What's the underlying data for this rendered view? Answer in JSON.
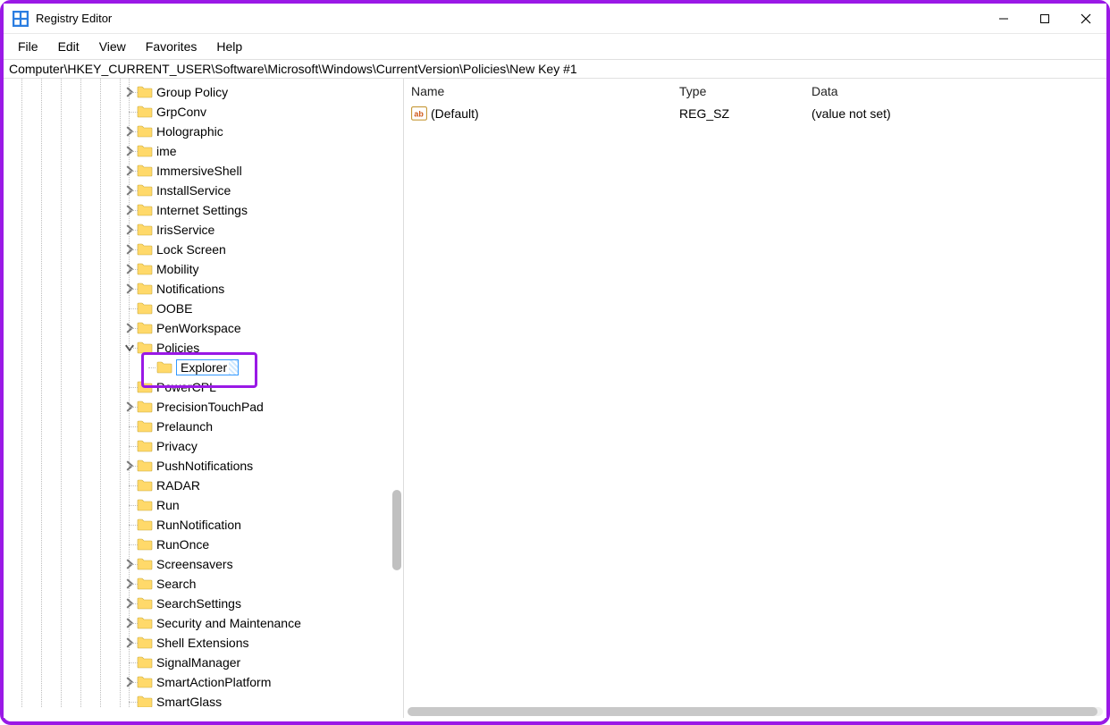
{
  "window": {
    "title": "Registry Editor"
  },
  "menu": {
    "file": "File",
    "edit": "Edit",
    "view": "View",
    "favorites": "Favorites",
    "help": "Help"
  },
  "address": "Computer\\HKEY_CURRENT_USER\\Software\\Microsoft\\Windows\\CurrentVersion\\Policies\\New Key #1",
  "tree": {
    "items": [
      {
        "label": "Group Policy",
        "expandable": true
      },
      {
        "label": "GrpConv",
        "expandable": false
      },
      {
        "label": "Holographic",
        "expandable": true
      },
      {
        "label": "ime",
        "expandable": true
      },
      {
        "label": "ImmersiveShell",
        "expandable": true
      },
      {
        "label": "InstallService",
        "expandable": true
      },
      {
        "label": "Internet Settings",
        "expandable": true
      },
      {
        "label": "IrisService",
        "expandable": true
      },
      {
        "label": "Lock Screen",
        "expandable": true
      },
      {
        "label": "Mobility",
        "expandable": true
      },
      {
        "label": "Notifications",
        "expandable": true
      },
      {
        "label": "OOBE",
        "expandable": false
      },
      {
        "label": "PenWorkspace",
        "expandable": true
      },
      {
        "label": "Policies",
        "expandable": true,
        "expanded": true
      },
      {
        "label": "Explorer",
        "child": true,
        "editing": true
      },
      {
        "label": "PowerCPL",
        "expandable": false
      },
      {
        "label": "PrecisionTouchPad",
        "expandable": true
      },
      {
        "label": "Prelaunch",
        "expandable": false
      },
      {
        "label": "Privacy",
        "expandable": false
      },
      {
        "label": "PushNotifications",
        "expandable": true
      },
      {
        "label": "RADAR",
        "expandable": false
      },
      {
        "label": "Run",
        "expandable": false
      },
      {
        "label": "RunNotification",
        "expandable": false
      },
      {
        "label": "RunOnce",
        "expandable": false
      },
      {
        "label": "Screensavers",
        "expandable": true
      },
      {
        "label": "Search",
        "expandable": true
      },
      {
        "label": "SearchSettings",
        "expandable": true
      },
      {
        "label": "Security and Maintenance",
        "expandable": true
      },
      {
        "label": "Shell Extensions",
        "expandable": true
      },
      {
        "label": "SignalManager",
        "expandable": false
      },
      {
        "label": "SmartActionPlatform",
        "expandable": true
      },
      {
        "label": "SmartGlass",
        "expandable": false
      }
    ]
  },
  "values": {
    "headers": {
      "name": "Name",
      "type": "Type",
      "data": "Data"
    },
    "rows": [
      {
        "name": "(Default)",
        "type": "REG_SZ",
        "data": "(value not set)"
      }
    ]
  }
}
